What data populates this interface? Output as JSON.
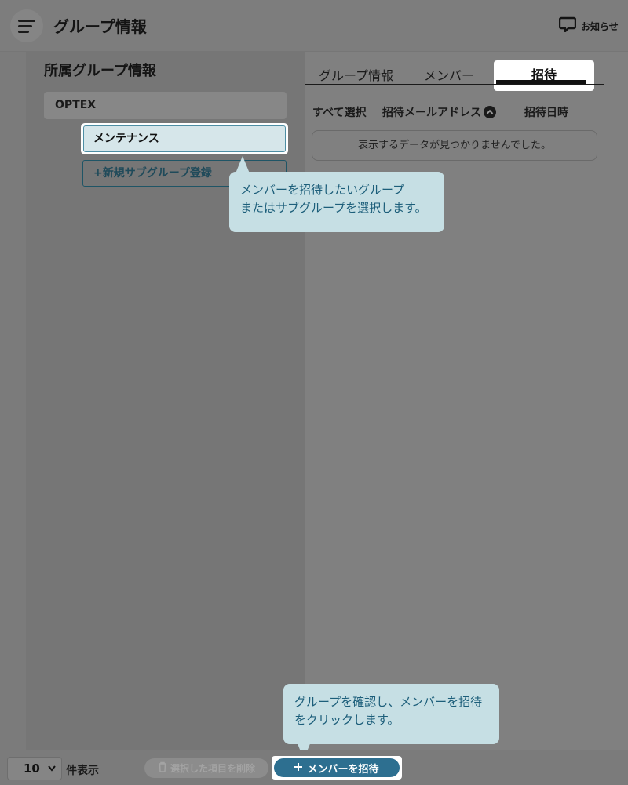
{
  "header": {
    "title": "グループ情報",
    "notice_label": "お知らせ",
    "menu_icon": "hamburger-menu-icon",
    "notice_icon": "chat-bubble-icon"
  },
  "left": {
    "heading": "所属グループ情報",
    "group": "OPTEX",
    "subgroup": "メンテナンス",
    "add_subgroup": "+新規サブグループ登録"
  },
  "tabs": [
    {
      "label": "グループ情報"
    },
    {
      "label": "メンバー"
    },
    {
      "label": "招待",
      "active": true
    }
  ],
  "table": {
    "col_select": "すべて選択",
    "col_email": "招待メールアドレス",
    "col_date": "招待日時",
    "empty": "表示するデータが見つかりませんでした。",
    "sort_icon": "sort-up-icon"
  },
  "tooltips": {
    "tip1_line1": "メンバーを招待したいグループ",
    "tip1_line2": "またはサブグループを選択します。",
    "tip2_line1": "グループを確認し、メンバーを招待",
    "tip2_line2": "をクリックします。"
  },
  "footer": {
    "per_page_value": "10",
    "per_page_label": "件表示",
    "delete_label": "選択した項目を削除",
    "invite_label": "メンバーを招待",
    "invite_icon": "plus-icon",
    "delete_icon": "trash-icon"
  },
  "colors": {
    "accent": "#2d6f90",
    "tooltip_bg": "#c6dfe4",
    "tooltip_text": "#1c5e7a",
    "overlay": "#808080"
  }
}
